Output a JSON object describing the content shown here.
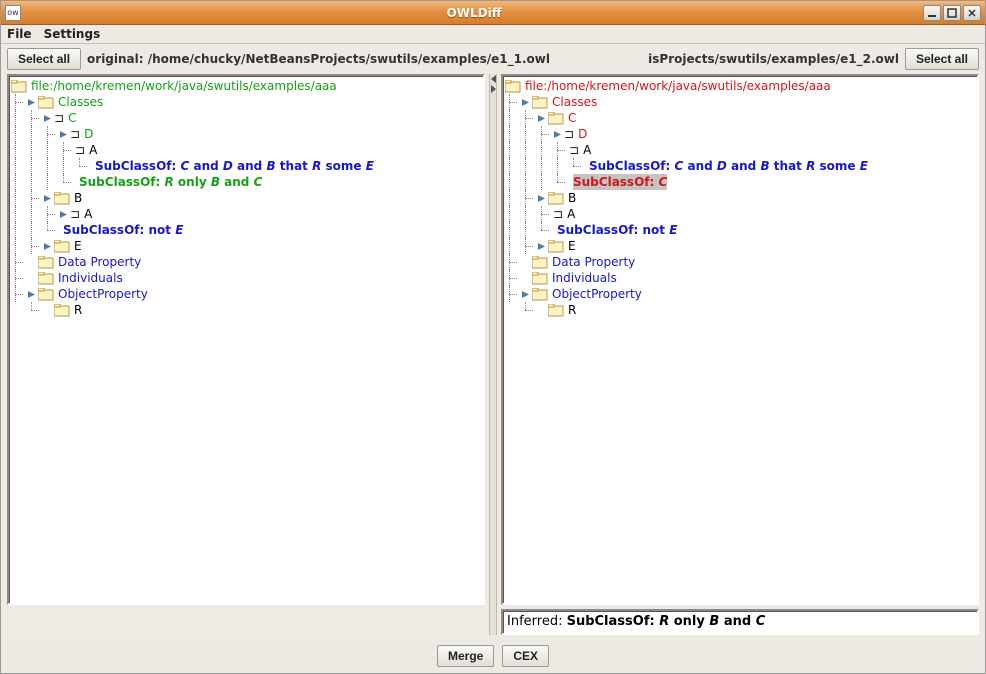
{
  "window": {
    "title": "OWLDiff"
  },
  "menu": {
    "file": "File",
    "settings": "Settings"
  },
  "toolbar": {
    "select_all_left": "Select all",
    "select_all_right": "Select all",
    "path_label_prefix": "original: ",
    "path_left": "/home/chucky/NetBeansProjects/swutils/examples/e1_1.owl",
    "path_right": "isProjects/swutils/examples/e1_2.owl"
  },
  "left_tree": {
    "root": "file:/home/kremen/work/java/swutils/examples/aaa",
    "classes": "Classes",
    "c": "C",
    "d": "D",
    "a1": "A",
    "sc_long_parts": [
      "SubClassOf: ",
      "C",
      " and ",
      "D",
      " and ",
      "B",
      " that ",
      "R",
      " some ",
      "E"
    ],
    "sc_green_parts": [
      "SubClassOf: ",
      "R",
      " only ",
      "B",
      " and ",
      "C"
    ],
    "b": "B",
    "a2": "A",
    "sc_notE_parts": [
      "SubClassOf: ",
      " not ",
      "E"
    ],
    "e": "E",
    "data_property": "Data Property",
    "individuals": "Individuals",
    "object_property": "ObjectProperty",
    "r": "R"
  },
  "right_tree": {
    "root": "file:/home/kremen/work/java/swutils/examples/aaa",
    "classes": "Classes",
    "c": "C",
    "d": "D",
    "a1": "A",
    "sc_long_parts": [
      "SubClassOf: ",
      "C",
      " and ",
      "D",
      " and ",
      "B",
      " that ",
      "R",
      " some ",
      "E"
    ],
    "sc_red_parts": [
      "SubClassOf: ",
      "C"
    ],
    "b": "B",
    "a2": "A",
    "sc_notE_parts": [
      "SubClassOf: ",
      " not ",
      "E"
    ],
    "e": "E",
    "data_property": "Data Property",
    "individuals": "Individuals",
    "object_property": "ObjectProperty",
    "r": "R"
  },
  "inferred_parts": [
    "Inferred: ",
    "SubClassOf: ",
    "R",
    " only ",
    "B",
    " and ",
    "C"
  ],
  "bottom": {
    "merge": "Merge",
    "cex": "CEX"
  }
}
